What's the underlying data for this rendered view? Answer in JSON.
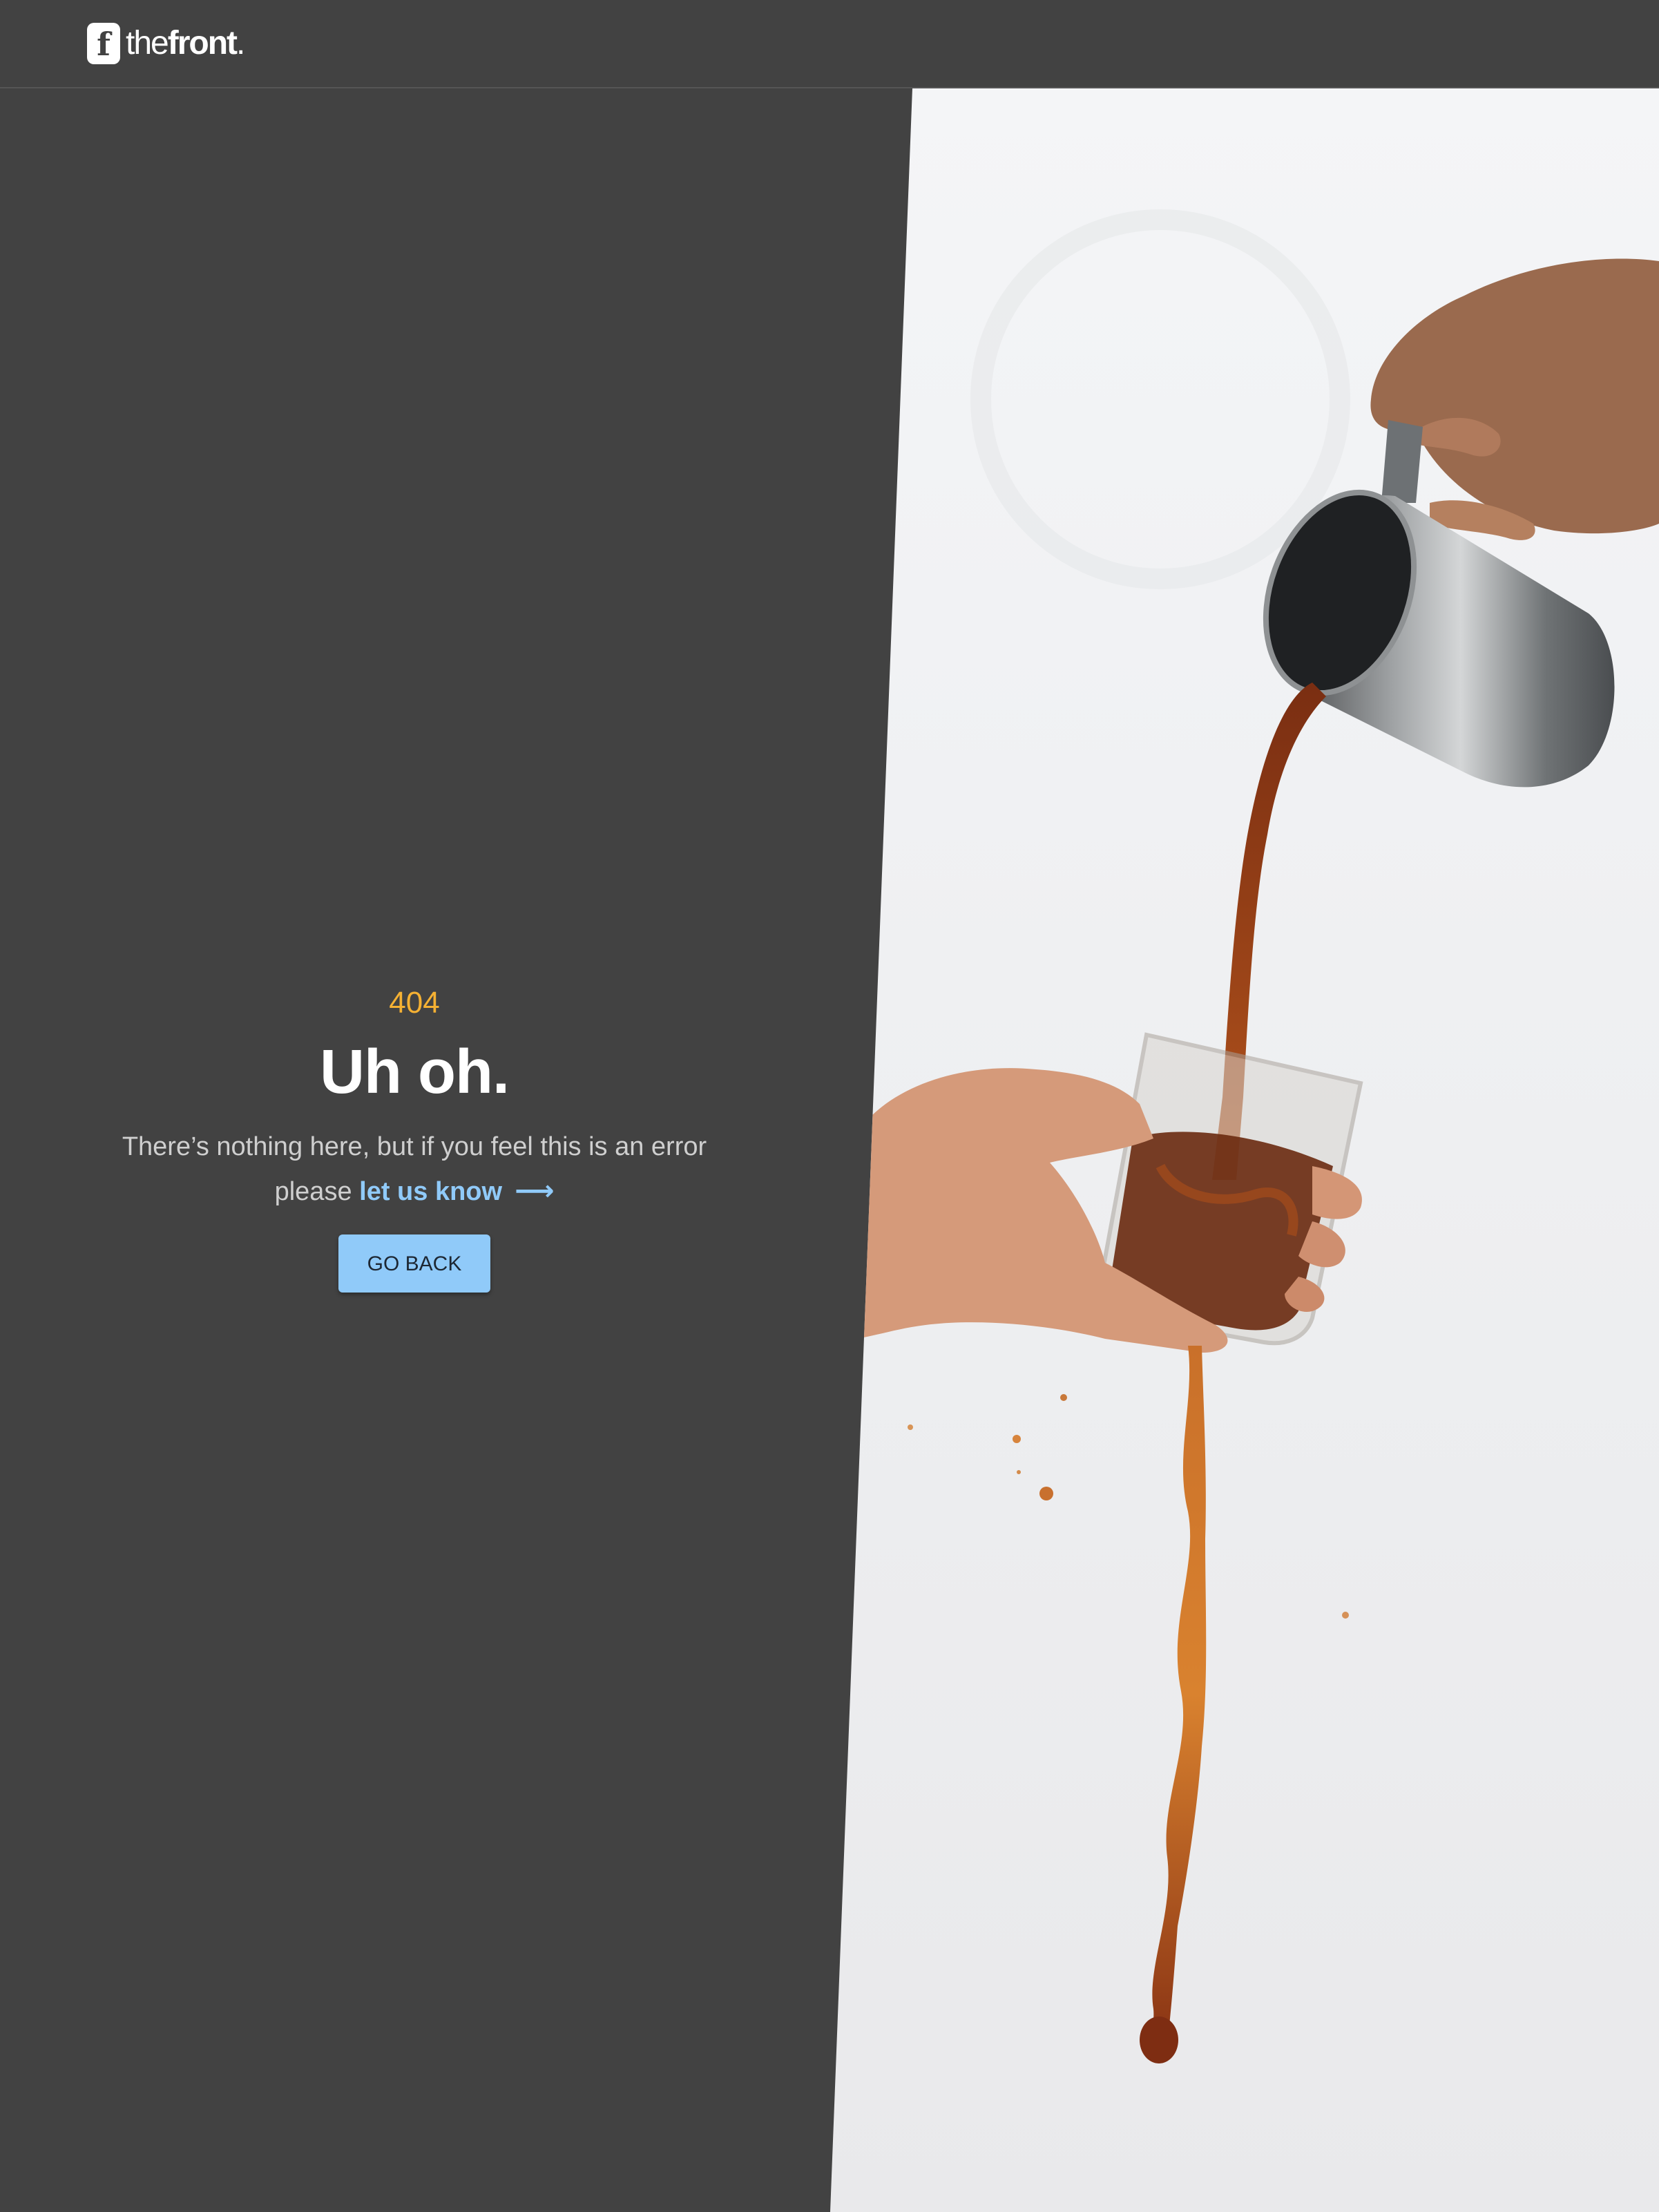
{
  "header": {
    "logo_mark": "f",
    "logo_text_light": "the",
    "logo_text_bold": "front",
    "logo_dot": "."
  },
  "error": {
    "code": "404",
    "title": "Uh oh.",
    "message_part1": "There’s nothing here, but if you feel this is an error",
    "message_part2": "please",
    "link_label": "let us know",
    "arrow": "⟶",
    "button_label": "GO BACK"
  },
  "colors": {
    "background": "#424242",
    "code_accent": "#f5b133",
    "link": "#90caf9",
    "button": "#90caf9"
  },
  "image": {
    "subject": "hand pouring coffee from a steel pitcher into a glass held by another hand"
  }
}
